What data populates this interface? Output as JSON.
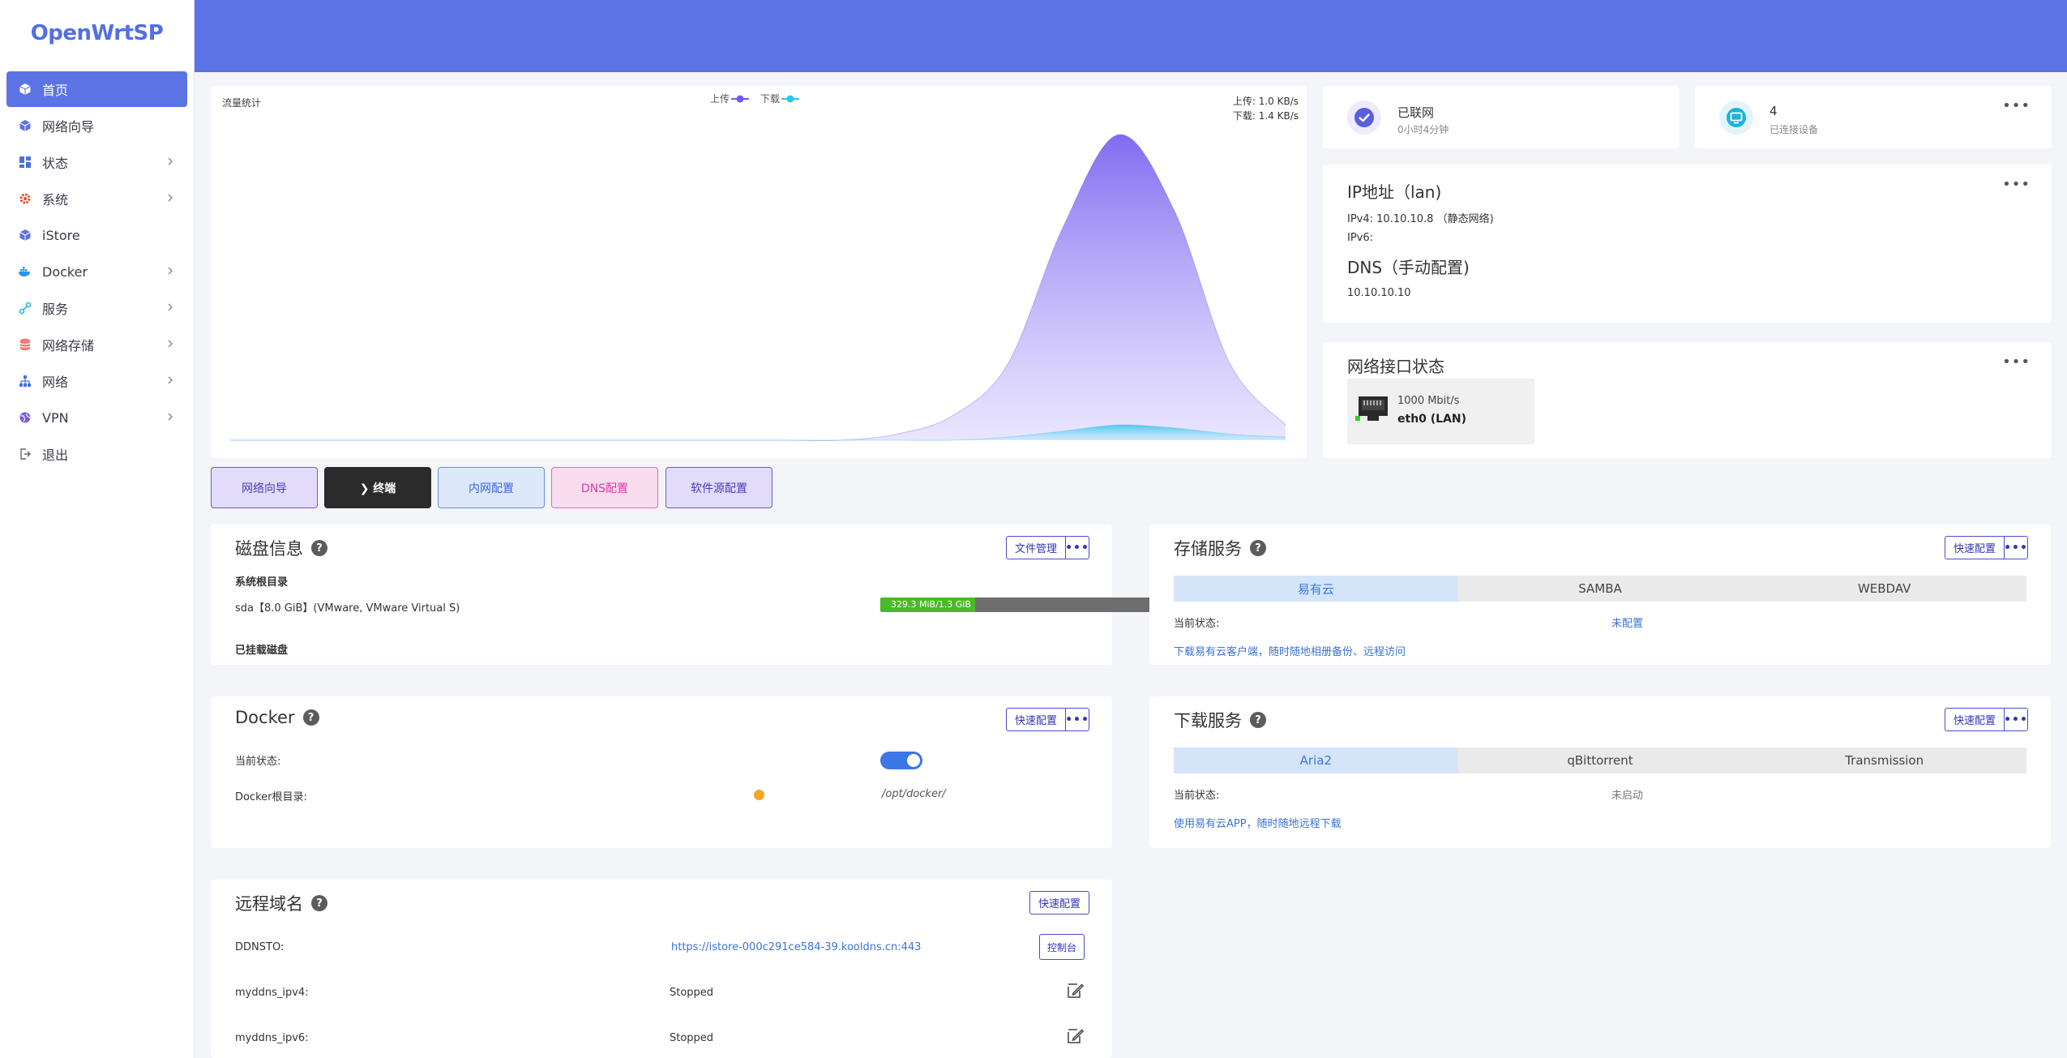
{
  "brand": {
    "logo_text": "OpenWrtSP"
  },
  "sidebar": {
    "items": [
      {
        "label": "首页",
        "icon": "home-cube-icon",
        "active": true,
        "has_children": false
      },
      {
        "label": "网络向导",
        "icon": "cube-icon",
        "active": false,
        "has_children": false
      },
      {
        "label": "状态",
        "icon": "dashboard-icon",
        "active": false,
        "has_children": true
      },
      {
        "label": "系统",
        "icon": "gear-icon",
        "active": false,
        "has_children": true
      },
      {
        "label": "iStore",
        "icon": "cube-icon",
        "active": false,
        "has_children": false
      },
      {
        "label": "Docker",
        "icon": "docker-icon",
        "active": false,
        "has_children": true
      },
      {
        "label": "服务",
        "icon": "services-icon",
        "active": false,
        "has_children": true
      },
      {
        "label": "网络存储",
        "icon": "storage-icon",
        "active": false,
        "has_children": true
      },
      {
        "label": "网络",
        "icon": "network-icon",
        "active": false,
        "has_children": true
      },
      {
        "label": "VPN",
        "icon": "globe-icon",
        "active": false,
        "has_children": true
      },
      {
        "label": "退出",
        "icon": "logout-icon",
        "active": false,
        "has_children": false
      }
    ]
  },
  "traffic": {
    "title": "流量统计",
    "legend_upload": "上传",
    "legend_download": "下载",
    "upload_rate": "上传: 1.0 KB/s",
    "download_rate": "下载: 1.4 KB/s",
    "upload_color": "#6b5cf0",
    "download_color": "#33c3e9"
  },
  "chart_data": {
    "type": "area",
    "series": [
      {
        "name": "上传",
        "values": [
          0,
          0,
          0,
          0,
          0,
          0,
          0,
          0,
          0,
          0,
          0,
          0,
          0.02,
          0.08,
          0.25,
          0.7,
          1.0,
          0.75,
          0.25,
          0.05
        ]
      },
      {
        "name": "下载",
        "values": [
          0,
          0,
          0,
          0,
          0,
          0,
          0,
          0,
          0,
          0,
          0,
          0,
          0,
          0,
          0.01,
          0.03,
          0.05,
          0.04,
          0.02,
          0.01
        ]
      }
    ]
  },
  "status": {
    "connection": {
      "main": "已联网",
      "sub": "0小时4分钟",
      "icon": "check-icon",
      "color": "#5a5fe0"
    },
    "devices": {
      "main": "4",
      "sub": "已连接设备",
      "icon": "monitor-icon",
      "color": "#1ab4d8"
    },
    "more_label": "•••"
  },
  "ip": {
    "title": "IP地址（lan)",
    "ipv4": "IPv4: 10.10.10.8 （静态网络)",
    "ipv6": "IPv6:",
    "dns_title": "DNS（手动配置)",
    "dns_value": "10.10.10.10"
  },
  "iface": {
    "title": "网络接口状态",
    "speed": "1000 Mbit/s",
    "name": "eth0 (LAN)"
  },
  "quick_buttons": [
    {
      "label": "网络向导",
      "bg": "#e2dcfa",
      "border": "#6e5bd0",
      "color": "#4a3cb8"
    },
    {
      "label": "❯ 终端",
      "bg": "#2b2b2b",
      "border": "#2b2b2b",
      "color": "#ffffff"
    },
    {
      "label": "内网配置",
      "bg": "#dde8fa",
      "border": "#6b8ee6",
      "color": "#3a68d8"
    },
    {
      "label": "DNS配置",
      "bg": "#fadcef",
      "border": "#e66bb8",
      "color": "#e03aa8"
    },
    {
      "label": "软件源配置",
      "bg": "#e2dcfa",
      "border": "#6e5bd0",
      "color": "#4a3cb8"
    }
  ],
  "disk": {
    "title": "磁盘信息",
    "button": "文件管理",
    "root_label": "系统根目录",
    "root_device": "sda【8.0 GiB】(VMware, VMware Virtual S)",
    "usage_text": "329.3 MiB/1.3 GiB",
    "usage_fraction": 0.247,
    "mounted_label": "已挂载磁盘"
  },
  "storage": {
    "title": "存储服务",
    "button": "快速配置",
    "tabs": [
      "易有云",
      "SAMBA",
      "WEBDAV"
    ],
    "status_label": "当前状态:",
    "status_value": "未配置",
    "link": "下载易有云客户端，随时随地相册备份、远程访问"
  },
  "docker": {
    "title": "Docker",
    "button": "快速配置",
    "status_label": "当前状态:",
    "root_label": "Docker根目录:",
    "root_value": "/opt/docker/"
  },
  "download": {
    "title": "下载服务",
    "button": "快速配置",
    "tabs": [
      "Aria2",
      "qBittorrent",
      "Transmission"
    ],
    "status_label": "当前状态:",
    "status_value": "未启动",
    "link": "使用易有云APP，随时随地远程下载"
  },
  "remote": {
    "title": "远程域名",
    "button": "快速配置",
    "ddnsto_label": "DDNSTO:",
    "ddnsto_url": "https://istore-000c291ce584-39.kooldns.cn:443",
    "console_button": "控制台",
    "rows": [
      {
        "label": "myddns_ipv4:",
        "value": "Stopped"
      },
      {
        "label": "myddns_ipv6:",
        "value": "Stopped"
      }
    ]
  },
  "help_glyph": "?"
}
